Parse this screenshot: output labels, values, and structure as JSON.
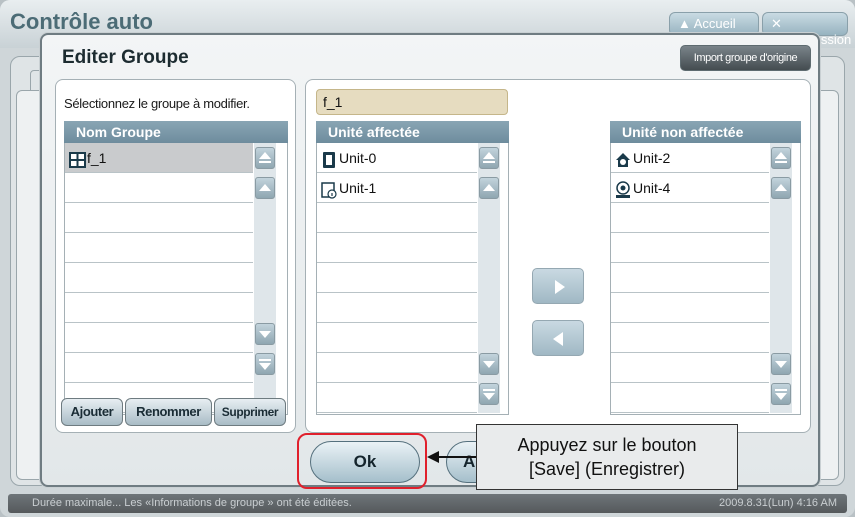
{
  "background": {
    "title": "Contrôle auto",
    "home_button": "Accueil",
    "close_button": "Ferm.Session"
  },
  "dialog": {
    "title": "Editer Groupe",
    "import_button": "Import groupe d'origine",
    "select_label": "Sélectionnez le groupe à modifier.",
    "group_list_header": "Nom Groupe",
    "groups": [
      "f_1"
    ],
    "add_button": "Ajouter",
    "rename_button": "Renommer",
    "delete_button": "Supprimer",
    "group_name_value": "f_1",
    "assigned_header": "Unité affectée",
    "assigned_units": [
      "Unit-0",
      "Unit-1"
    ],
    "unassigned_header": "Unité non affectée",
    "unassigned_units": [
      "Unit-2",
      "Unit-4"
    ],
    "ok_button": "Ok",
    "cancel_button": "A"
  },
  "callout": {
    "line1": "Appuyez sur le bouton",
    "line2": "[Save] (Enregistrer)"
  },
  "status": {
    "message": "Durée maximale... Les «Informations de groupe » ont été éditées.",
    "datetime": "2009.8.31(Lun)  4:16 AM"
  },
  "colors": {
    "highlight": "#e0202c",
    "header": "#7d98a8"
  }
}
